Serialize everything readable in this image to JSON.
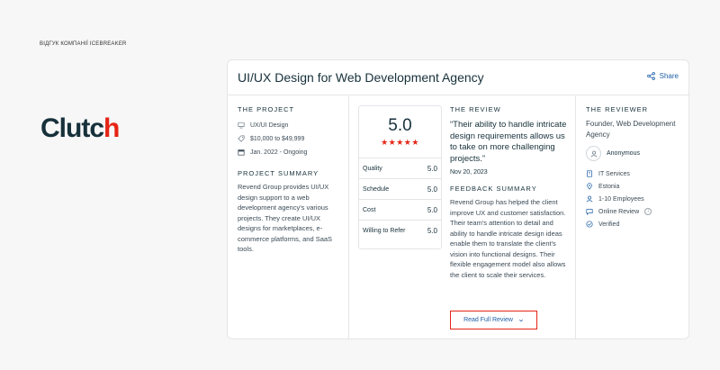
{
  "page": {
    "label": "Відгук компанії Icebreaker"
  },
  "logo": {
    "text": "Clutch",
    "brand_color": "#17313b",
    "accent_color": "#e62415"
  },
  "card": {
    "title": "UI/UX Design for Web Development Agency",
    "share_label": "Share"
  },
  "project": {
    "section_title": "The Project",
    "service": "UX/UI Design",
    "budget": "$10,000 to $49,999",
    "dates": "Jan. 2022 - Ongoing",
    "summary_title": "Project Summary",
    "summary": "Revend Group provides UI/UX design support to a web development agency's various projects. They create UI/UX designs for marketplaces, e-commerce platforms, and SaaS tools."
  },
  "review": {
    "section_title": "The Review",
    "rating": "5.0",
    "stars": "★★★★★",
    "scores": [
      {
        "label": "Quality",
        "value": "5.0"
      },
      {
        "label": "Schedule",
        "value": "5.0"
      },
      {
        "label": "Cost",
        "value": "5.0"
      },
      {
        "label": "Willing to Refer",
        "value": "5.0"
      }
    ],
    "quote": "“Their ability to handle intricate design requirements allows us to take on more challenging projects.”",
    "date": "Nov 20, 2023",
    "feedback_title": "Feedback Summary",
    "feedback": "Revend Group has helped the client improve UX and customer satisfaction. Their team's attention to detail and ability to handle intricate design ideas enable them to translate the client's vision into functional designs. Their flexible engagement model also allows the client to scale their services.",
    "read_full_label": "Read Full Review"
  },
  "reviewer": {
    "section_title": "The Reviewer",
    "role": "Founder, Web Development Agency",
    "name": "Anonymous",
    "industry": "IT Services",
    "location": "Estonia",
    "size": "1-10 Employees",
    "review_type": "Online Review",
    "verified": "Verified"
  },
  "colors": {
    "link": "#1f5fa6",
    "star": "#e62415",
    "border": "#e3e5e8"
  }
}
